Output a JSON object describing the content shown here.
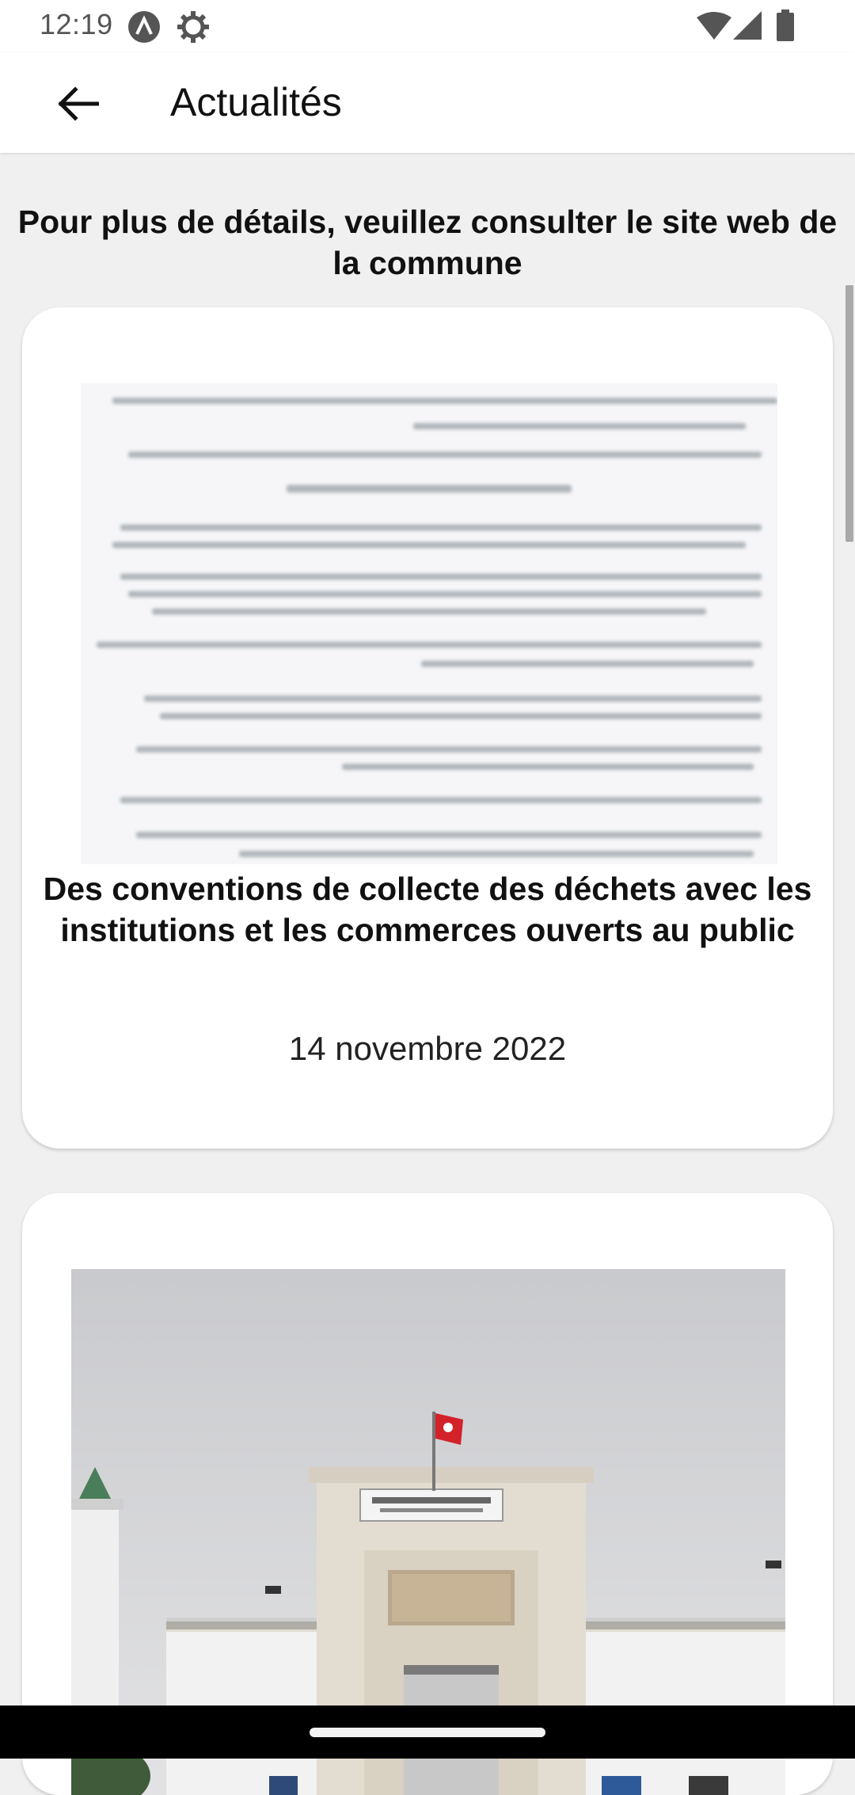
{
  "status_bar": {
    "time": "12:19",
    "icons": [
      "a-circle-icon",
      "gear-icon",
      "wifi-icon",
      "signal-icon",
      "battery-icon"
    ]
  },
  "app_bar": {
    "back_icon": "arrow-left-icon",
    "title": "Actualités"
  },
  "notice": "Pour plus de détails, veuillez consulter le site web de la commune",
  "news": [
    {
      "image": "blurred-document",
      "title": "Des conventions de collecte des déchets avec les institutions et les commerces ouverts au public",
      "date": "14 novembre 2022"
    },
    {
      "image": "fish-market-building-photo",
      "title": "",
      "date": ""
    }
  ],
  "colors": {
    "background": "#f0f0f0",
    "card": "#ffffff",
    "flag": "#d3222a"
  }
}
